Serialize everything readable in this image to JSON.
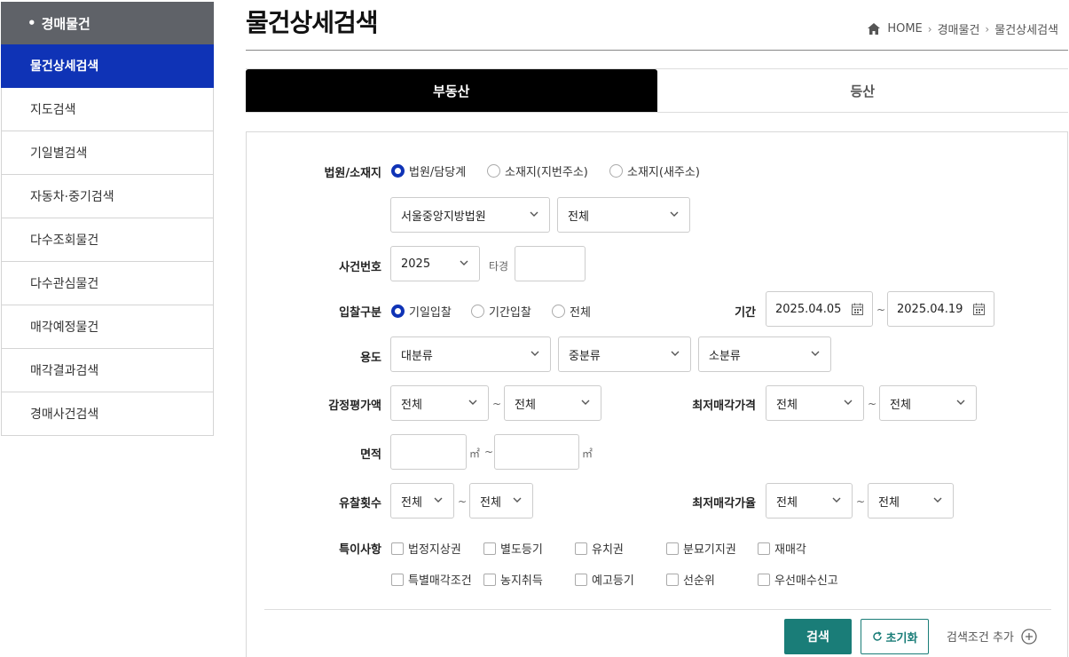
{
  "sidebar": {
    "header": "경매물건",
    "items": [
      {
        "label": "물건상세검색",
        "active": true
      },
      {
        "label": "지도검색"
      },
      {
        "label": "기일별검색"
      },
      {
        "label": "자동차·중기검색"
      },
      {
        "label": "다수조회물건"
      },
      {
        "label": "다수관심물건"
      },
      {
        "label": "매각예정물건"
      },
      {
        "label": "매각결과검색"
      },
      {
        "label": "경매사건검색"
      }
    ]
  },
  "header": {
    "title": "물건상세검색",
    "breadcrumb": [
      "HOME",
      "경매물건",
      "물건상세검색"
    ]
  },
  "tabs": [
    {
      "label": "부동산",
      "active": true
    },
    {
      "label": "등산"
    }
  ],
  "form": {
    "court_label": "법원/소재지",
    "court_options": [
      "법원/담당계",
      "소재지(지번주소)",
      "소재지(새주소)"
    ],
    "court_select": "서울중앙지방법원",
    "dept_select": "전체",
    "case_label": "사건번호",
    "case_year": "2025",
    "case_type_label": "타경",
    "case_number": "",
    "bid_label": "입찰구분",
    "bid_options": [
      "기일입찰",
      "기간입찰",
      "전체"
    ],
    "period_label": "기간",
    "period_from": "2025.04.05",
    "period_to": "2025.04.19",
    "use_label": "용도",
    "use_major": "대분류",
    "use_middle": "중분류",
    "use_minor": "소분류",
    "appraisal_label": "감정평가액",
    "appraisal_from": "전체",
    "appraisal_to": "전체",
    "min_price_label": "최저매각가격",
    "min_price_from": "전체",
    "min_price_to": "전체",
    "area_label": "면적",
    "area_unit": "㎡",
    "fail_label": "유찰횟수",
    "fail_from": "전체",
    "fail_to": "전체",
    "min_rate_label": "최저매각가율",
    "min_rate_from": "전체",
    "min_rate_to": "전체",
    "special_label": "특이사항",
    "special_row1": [
      "법정지상권",
      "별도등기",
      "유치권",
      "분묘기지권",
      "재매각"
    ],
    "special_row2": [
      "특별매각조건",
      "농지취득",
      "예고등기",
      "선순위",
      "우선매수신고"
    ],
    "tilde": "~"
  },
  "actions": {
    "search": "검색",
    "reset": "초기화",
    "add_condition": "검색조건 추가"
  },
  "colors": {
    "sidebar_active": "#0f33b6",
    "sidebar_header": "#5f6268",
    "search_button": "#1a7d78"
  }
}
